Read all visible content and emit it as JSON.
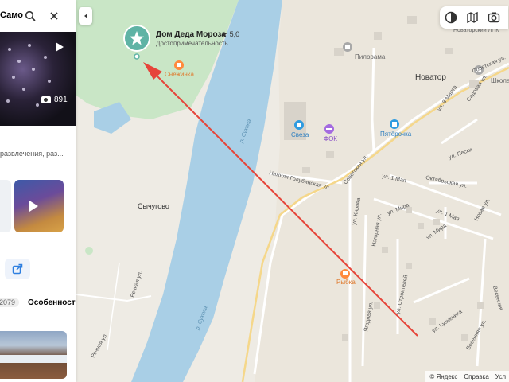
{
  "search": {
    "query": "Само"
  },
  "hero": {
    "photo_count": "891"
  },
  "panel": {
    "description": "развлечения, раз...",
    "reviews_tab": "2079",
    "features_tab": "Особенности"
  },
  "poi": {
    "name": "Дом Деда Мороза",
    "rating": "★ 5,0",
    "category": "Достопримечательность"
  },
  "map_labels": {
    "sneginka": "Снежинка",
    "novatorskiy_lpk": "Новаторский ЛПК",
    "pilorama": "Пилорама",
    "novator": "Новатор",
    "shkola": "Школа",
    "sovetskaya_ul_1": "Советская ул.",
    "sovetskaya_ul_2": "Советская ул.",
    "ul_8_marta": "ул. 8 Марта",
    "sadovaya_ul": "Садовая ул.",
    "sukhona_1": "р. Сухона",
    "sukhona_2": "р. Сухона",
    "sveza": "Свеза",
    "fok": "ФОК",
    "pyaterochka": "Пятёрочка",
    "ul_peski": "ул. Пески",
    "nizhnyaya_golubinskaya": "Нижняя Голубинская ул.",
    "oktyabrskaya": "Октябрьская ул.",
    "ul_1_maya_a": "ул. 1 Мая",
    "ul_1_maya_b": "ул. 1 Мая",
    "sychugovo": "Сычугово",
    "ul_kirova": "ул. Кирова",
    "ul_mira_a": "ул. Мира",
    "ul_mira_b": "ул. Мира",
    "novaya_ul": "Новая ул.",
    "nagornaya_ul": "Нагорная ул.",
    "rybka": "Рыбка",
    "rechnaya_ul": "Речная ул.",
    "ul_stroiteley": "ул. Строителей",
    "vesennyaya": "Весенняя",
    "yagodnaya_ul": "Ягодная ул.",
    "ul_kuznechikhi": "ул. Кузнечиха",
    "vesennyaya_ul": "Весенняя ул.",
    "rechnaya_ul_2": "Речная ул."
  },
  "footer": {
    "yandex": "© Яндекс",
    "help": "Справка",
    "terms": "Усл"
  },
  "icons": {
    "search": "search-icon",
    "close": "close-icon",
    "play": "play-icon",
    "camera": "camera-icon",
    "share": "share-icon",
    "collapse": "chevron-left-icon",
    "layers": "layers-icon",
    "theme": "theme-icon",
    "panorama": "panorama-icon",
    "poi_star": "star-icon"
  },
  "colors": {
    "water": "#a9cfe6",
    "park": "#c9e6c6",
    "poi_marker": "#5fb3a5",
    "arrow": "#e6453a",
    "cafe": "#ff8a3d",
    "fitness": "#a46be0",
    "shop": "#2e9be0"
  }
}
